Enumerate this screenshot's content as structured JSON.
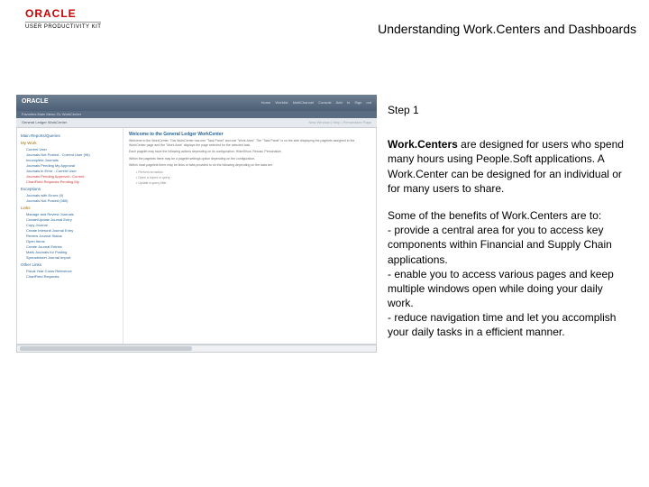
{
  "header": {
    "logo_text": "ORACLE",
    "upk_text": "USER PRODUCTIVITY KIT",
    "title": "Understanding Work.Centers and Dashboards"
  },
  "shot": {
    "topbar_logo": "ORACLE",
    "topbar_nav": "Favorites   Main Menu   GL   WorkCenter",
    "topbar_right": "Home   Worklist   MultiChannel Console   Add to   Sign out",
    "strip_left": "General Ledger WorkCenter",
    "strip_right": "New Window | Help | Personalize Page",
    "side": {
      "main_label": "Main   Reports/Queries",
      "mywork_label": "My Work",
      "mywork_items": [
        "Current User",
        "Journals Not Posted - Current User (96)",
        "Incomplete Journals",
        "Journals Pending My Approval",
        "Journals in Error - Current User"
      ],
      "mywork_red": [
        "Journals Pending Approval - Current",
        "ChartField Requests Pending My"
      ],
      "exceptions_label": "Exceptions",
      "exceptions_items": [
        "Journals with Errors (0)",
        "Journals Not Posted (365)"
      ],
      "links_label": "Links",
      "links_items": [
        "Manage and Review Journals",
        "Create/Update Journal Entry",
        "Copy Journal",
        "Create Interunit Journal Entry",
        "Review Journal Status",
        "Open Items",
        "Create Journal Entries",
        "Mark Journals for Posting",
        "Spreadsheet Journal Import"
      ],
      "other_label": "Other Links",
      "other_items": [
        "Fiscal Year Cross Reference",
        "ChartField Requests"
      ]
    },
    "content": {
      "heading": "Welcome to the General Ledger WorkCenter",
      "para1": "Welcome to the WorkCenter. This WorkCenter has one \"Task Panel\" and one \"Work Area\". The \"Task Panel\" is on the side displaying the pagelets assigned to the WorkCenter page and the \"Work Area\" displays the page selected for the selected task.",
      "para2": "Each pagelet may have the following actions depending on its configuration: Hide/Show, Reload, Personalize.",
      "para3": "Within the pagelets there may be a pagelet settings option depending on the configuration.",
      "bullets_hdr": "Within most pagelets there may be links or tabs provided to do the following depending on the data set:",
      "bullet1": "• Perform an action",
      "bullet2": "• Open a report or query",
      "bullet3": "• Update a query filter"
    }
  },
  "right": {
    "step": "Step 1",
    "p1_bold": "Work.Centers",
    "p1_rest": " are designed for users who spend many hours using People.Soft applications. A Work.Center can be designed for an individual or for many users to share.",
    "p2": "Some of the benefits of Work.Centers are to:",
    "b1": "- provide a central area for you to access key components within Financial and Supply Chain applications.",
    "b2": "- enable you to access various pages and keep multiple windows open while doing your daily work.",
    "b3": "- reduce navigation time and let you accomplish your daily tasks in a efficient manner."
  }
}
